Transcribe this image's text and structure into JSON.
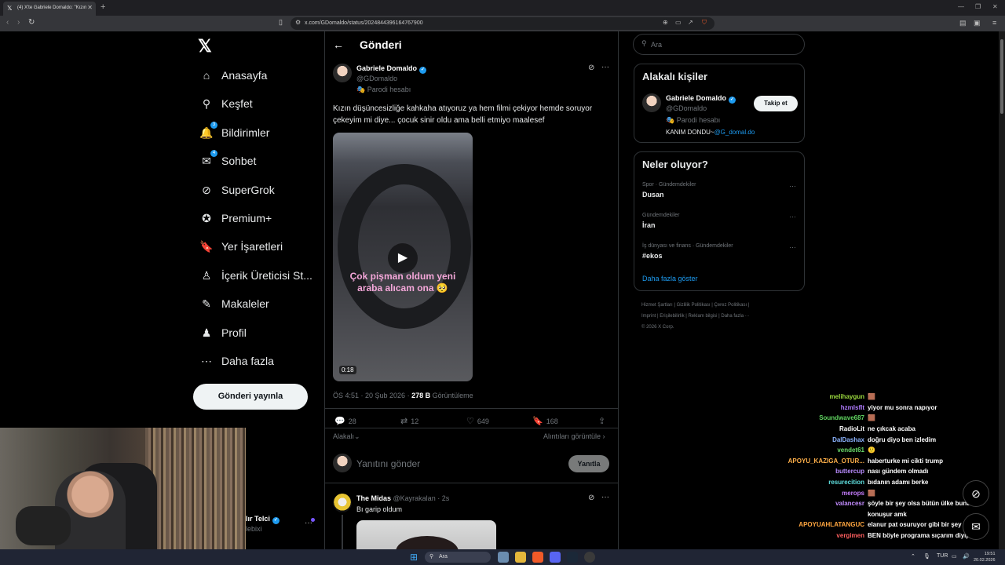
{
  "browser": {
    "tab_title": "(4) X'te Gabriele Domaldo: \"Kızın",
    "url": "x.com/GDomaldo/status/2024844396164767900"
  },
  "nav": {
    "items": [
      {
        "label": "Anasayfa",
        "icon": "home-icon"
      },
      {
        "label": "Keşfet",
        "icon": "search-icon"
      },
      {
        "label": "Bildirimler",
        "icon": "bell-icon",
        "badge": "3"
      },
      {
        "label": "Sohbet",
        "icon": "mail-icon",
        "badge": "4"
      },
      {
        "label": "SuperGrok",
        "icon": "grok-icon"
      },
      {
        "label": "Premium+",
        "icon": "premium-icon"
      },
      {
        "label": "Yer İşaretleri",
        "icon": "bookmark-icon"
      },
      {
        "label": "İçerik Üreticisi St...",
        "icon": "creator-icon"
      },
      {
        "label": "Makaleler",
        "icon": "articles-icon"
      },
      {
        "label": "Profil",
        "icon": "profile-icon"
      },
      {
        "label": "Daha fazla",
        "icon": "more-icon"
      }
    ],
    "post_button": "Gönderi yayınla"
  },
  "header": {
    "title": "Gönderi"
  },
  "tweet": {
    "name": "Gabriele Domaldo",
    "handle": "@GDomaldo",
    "parody": "Parodi hesabı",
    "text": "Kızın düşüncesizliğe kahkaha atıyoruz ya hem filmi çekiyor hemde soruyor çekeyim mi diye... çocuk sinir oldu ama belli etmiyo maalesef",
    "video_caption": "Çok pişman oldum yeni araba alıcam ona 🥺",
    "video_duration": "0:18",
    "time": "ÖS 4:51 · 20 Şub 2026 · ",
    "views": "278 B",
    "views_label": " Görüntüleme",
    "replies": "28",
    "reposts": "12",
    "likes": "649",
    "bookmarks": "168",
    "sort_label": "Alakalı",
    "quotes_label": "Alıntıları görüntüle"
  },
  "reply_box": {
    "placeholder": "Yanıtını gönder",
    "button": "Yanıtla"
  },
  "reply": {
    "name": "The Midas",
    "handle": "@Kayrakalan · 2s",
    "text": "Bı garip oldum"
  },
  "sidebar": {
    "search_placeholder": "Ara",
    "relevant": {
      "title": "Alakalı kişiler",
      "name": "Gabriele Domaldo",
      "handle": "@GDomaldo",
      "parody": "Parodi hesabı",
      "bio_prefix": "KANIM DONDU~",
      "bio_link": "@G_domal.do",
      "follow": "Takip et"
    },
    "trends": {
      "title": "Neler oluyor?",
      "items": [
        {
          "category": "Spor · Gündemdekiler",
          "name": "Dusan"
        },
        {
          "category": "Gündemdekiler",
          "name": "İran"
        },
        {
          "category": "İş dünyası ve finans · Gündemdekiler",
          "name": "#ekos"
        }
      ],
      "show_more": "Daha fazla göster"
    },
    "footer": [
      "Hizmet Şartları  |  Gizlilik Politikası  |  Çerez Politikası  |",
      "Imprint  |  Erişilebilirlik  |  Reklam bilgisi  |  Daha fazla ···",
      "© 2026 X Corp."
    ]
  },
  "profile_stub": {
    "name": "lır Telci",
    "handle": "lebixi"
  },
  "chat": [
    {
      "user": "melihaygun",
      "msg": "🟫",
      "color": "#9cdb3f"
    },
    {
      "user": "hzmlsflt",
      "msg": "yiyor mu sonra napıyor",
      "color": "#b17cff"
    },
    {
      "user": "Soundwave687",
      "msg": "🟫",
      "color": "#5fd35f"
    },
    {
      "user": "RadioLit",
      "msg": "ne çıkcak acaba",
      "color": "#ffffff"
    },
    {
      "user": "DalDashax",
      "msg": "doğru diyo ben izledim",
      "color": "#8cb4ff"
    },
    {
      "user": "vendet61",
      "msg": "🙂",
      "color": "#6bdc6b"
    },
    {
      "user": "APOYU_KAZIGA_OTUR...",
      "msg": "haberturke mi cikti trump",
      "color": "#ffb04a"
    },
    {
      "user": "buttercup",
      "msg": "nası gündem olmadı",
      "color": "#b98cff"
    },
    {
      "user": "resurecition",
      "msg": "bıdanın adamı berke",
      "color": "#5fe0e0"
    },
    {
      "user": "merops",
      "msg": "🟫",
      "color": "#c77dff"
    },
    {
      "user": "valancesr",
      "msg": "şöyle bir şey olsa bütün ülke bunu",
      "color": "#c38cff"
    },
    {
      "user": "",
      "msg": "konuşur amk",
      "color": "#ffffff"
    },
    {
      "user": "APOYUAHLATANGUC",
      "msg": "elanur pat osuruyor gibi bir şey mi",
      "color": "#ffa640"
    },
    {
      "user": "vergimen",
      "msg": "BEN böyle programa sıçarım diyip",
      "color": "#ff5f5f"
    }
  ],
  "taskbar": {
    "search": "Ara",
    "lang": "TUR",
    "time": "19:51",
    "date": "20.02.2026"
  }
}
